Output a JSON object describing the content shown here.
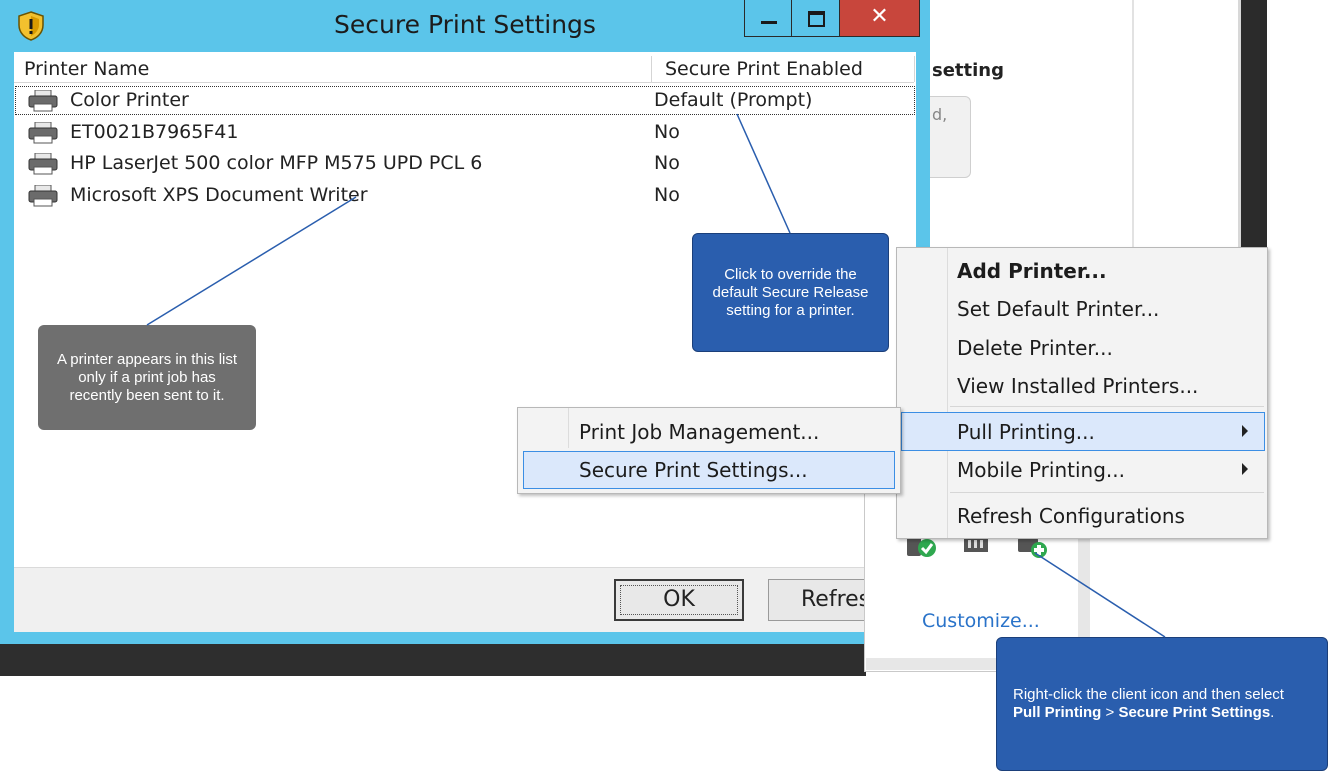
{
  "background": {
    "partial_heading": "setting",
    "partial_box_text": "d,"
  },
  "dialog": {
    "title": "Secure Print Settings",
    "columns": [
      "Printer Name",
      "Secure Print Enabled"
    ],
    "rows": [
      {
        "name": "Color Printer",
        "value": "Default (Prompt)"
      },
      {
        "name": "ET0021B7965F41",
        "value": "No"
      },
      {
        "name": "HP LaserJet 500 color MFP M575 UPD PCL 6",
        "value": "No"
      },
      {
        "name": "Microsoft XPS Document Writer",
        "value": "No"
      }
    ],
    "ok_label": "OK",
    "refresh_label": "Refresh"
  },
  "tray": {
    "customize_label": "Customize..."
  },
  "context_menu": {
    "items": [
      {
        "label": "Add Printer...",
        "bold": true
      },
      {
        "label": "Set Default Printer..."
      },
      {
        "label": "Delete Printer..."
      },
      {
        "label": "View Installed Printers..."
      },
      {
        "label": "Pull Printing...",
        "submenu": true,
        "highlighted": true
      },
      {
        "label": "Mobile Printing...",
        "submenu": true
      },
      {
        "label": "Refresh Configurations"
      }
    ]
  },
  "submenu": {
    "items": [
      {
        "label": "Print Job Management..."
      },
      {
        "label": "Secure Print Settings...",
        "highlighted": true
      }
    ]
  },
  "callouts": {
    "list_note": "A printer appears in this list only if a print job has recently been sent to it.",
    "override_note": "Click to override the default Secure Release setting for a printer.",
    "instruction_prefix": "Right-click the client icon and then select ",
    "instruction_bold_1": "Pull Printing",
    "instruction_sep": " > ",
    "instruction_bold_2": "Secure Print Settings",
    "instruction_suffix": "."
  },
  "colors": {
    "title_bar": "#5bc5ea",
    "close_button": "#c8463c",
    "callout_blue": "#2a5eae",
    "callout_gray": "#6f6f6f",
    "menu_highlight": "#dbe8fb",
    "menu_highlight_border": "#3b8ee4",
    "link": "#2a73c9"
  }
}
